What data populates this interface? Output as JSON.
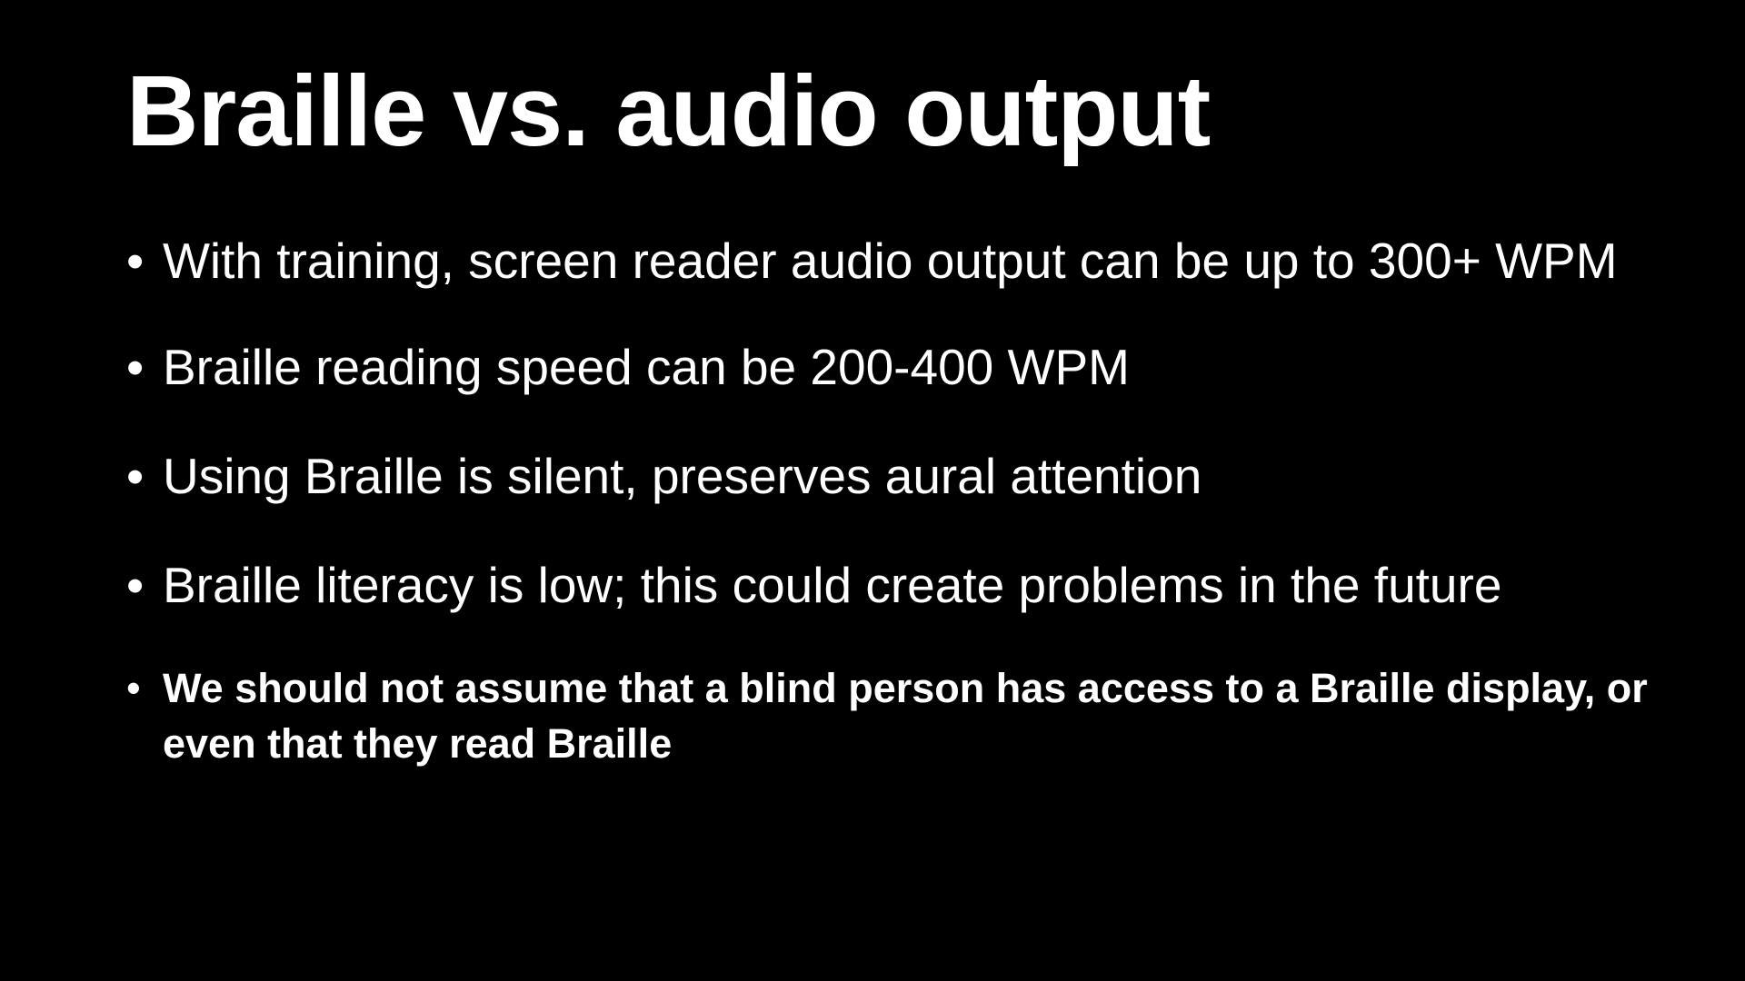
{
  "slide": {
    "title": "Braille vs. audio output",
    "bullet_glyph": "•",
    "bullets": [
      {
        "text": "With training, screen reader audio output can be up to 300+ WPM",
        "weight": "regular"
      },
      {
        "text": "Braille reading speed can be 200-400 WPM",
        "weight": "regular"
      },
      {
        "text": "Using Braille is silent, preserves aural attention",
        "weight": "regular"
      },
      {
        "text": "Braille literacy is low; this could create problems in the future",
        "weight": "regular"
      },
      {
        "text": "We should not assume that a blind person has access to a Braille display, or even that they read Braille",
        "weight": "bold"
      }
    ]
  },
  "colors": {
    "background": "#000000",
    "text": "#ffffff"
  }
}
